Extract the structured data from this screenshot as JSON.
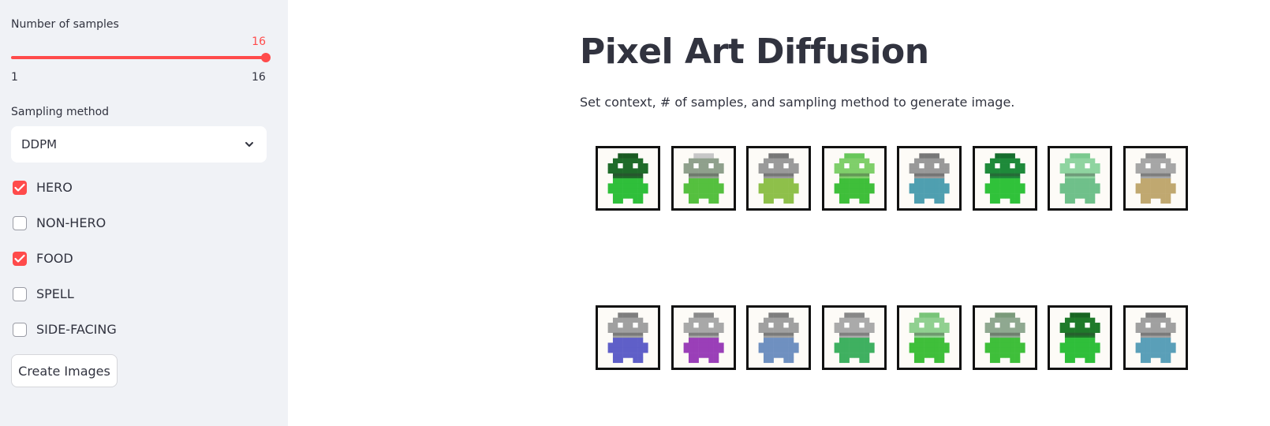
{
  "sidebar": {
    "slider": {
      "label": "Number of samples",
      "value": "16",
      "min": "1",
      "max": "16",
      "fraction": 1.0
    },
    "sampling": {
      "label": "Sampling method",
      "value": "DDPM"
    },
    "checkboxes": [
      {
        "label": "HERO",
        "checked": true
      },
      {
        "label": "NON-HERO",
        "checked": false
      },
      {
        "label": "FOOD",
        "checked": true
      },
      {
        "label": "SPELL",
        "checked": false
      },
      {
        "label": "SIDE-FACING",
        "checked": false
      }
    ],
    "button_label": "Create Images"
  },
  "main": {
    "title": "Pixel Art Diffusion",
    "subtitle": "Set context, # of samples, and sampling method to generate image."
  },
  "samples": [
    {
      "head": "#1f6b2a",
      "body": "#2fbf3a",
      "hat": "#1a5a22"
    },
    {
      "head": "#8fa08c",
      "body": "#55c03f",
      "hat": "#c7c7c7"
    },
    {
      "head": "#9a9a9a",
      "body": "#8ec04a",
      "hat": "#777777"
    },
    {
      "head": "#7fcf6a",
      "body": "#3fbf3a",
      "hat": "#68c75a"
    },
    {
      "head": "#999999",
      "body": "#4f9fb0",
      "hat": "#777777"
    },
    {
      "head": "#1e8a3a",
      "body": "#30c23a",
      "hat": "#156d2d"
    },
    {
      "head": "#8fd4a0",
      "body": "#6fc08a",
      "hat": "#7bc98f"
    },
    {
      "head": "#a6a6a6",
      "body": "#c0a870",
      "hat": "#8f8f8f"
    },
    {
      "head": "#a0a0a0",
      "body": "#5f5fc8",
      "hat": "#7e7e7e"
    },
    {
      "head": "#a8a8a8",
      "body": "#9a3fb8",
      "hat": "#8a8a8a"
    },
    {
      "head": "#a0a0a0",
      "body": "#6f90c0",
      "hat": "#7e7e7e"
    },
    {
      "head": "#aaaaaa",
      "body": "#3fb060",
      "hat": "#888888"
    },
    {
      "head": "#90d090",
      "body": "#3fbf3a",
      "hat": "#78c478"
    },
    {
      "head": "#8fa890",
      "body": "#3fbf3a",
      "hat": "#7a9a7a"
    },
    {
      "head": "#1f7a2a",
      "body": "#2fbf3a",
      "hat": "#176522"
    },
    {
      "head": "#a0a0a0",
      "body": "#5a9fb8",
      "hat": "#808080"
    }
  ]
}
